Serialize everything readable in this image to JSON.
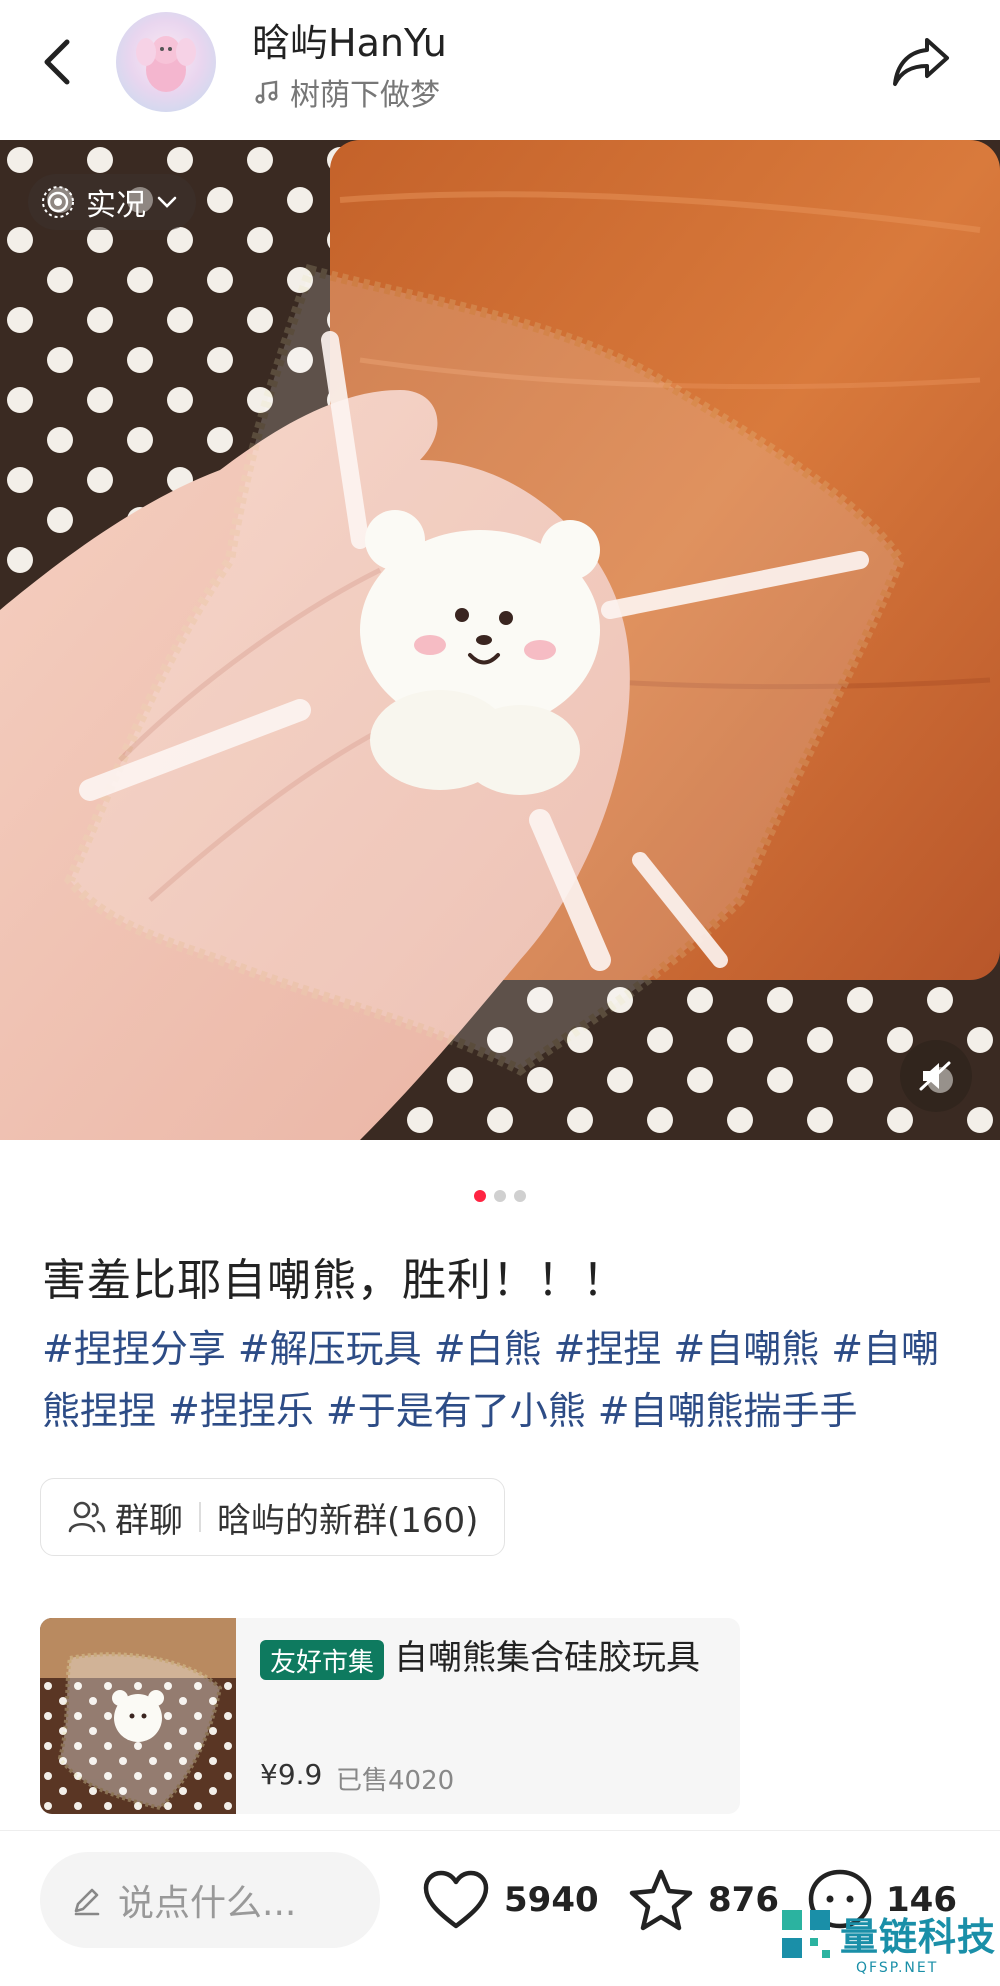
{
  "header": {
    "username": "晗屿HanYu",
    "music": "树荫下做梦"
  },
  "photo": {
    "live_label": "实况"
  },
  "pager": {
    "total": 3,
    "current": 1
  },
  "post": {
    "title": "害羞比耶自嘲熊，胜利！！！",
    "tags": [
      "#捏捏分享",
      "#解压玩具",
      "#白熊",
      "#捏捏",
      "#自嘲熊",
      "#自嘲熊捏捏",
      "#捏捏乐",
      "#于是有了小熊",
      "#自嘲熊揣手手"
    ]
  },
  "group": {
    "label": "群聊",
    "name": "晗屿的新群(160)"
  },
  "product": {
    "badge": "友好市集",
    "name": "自嘲熊集合硅胶玩具",
    "price": "¥9.9",
    "sold": "已售4020"
  },
  "bottom_bar": {
    "comment_placeholder": "说点什么...",
    "likes": "5940",
    "collects": "876",
    "comments": "146"
  },
  "watermark": {
    "title": "量链科技",
    "subtitle": "QFSP.NET"
  },
  "colors": {
    "accent": "#ff2442",
    "tag": "#2d4c86",
    "badge": "#0e7a5f"
  }
}
